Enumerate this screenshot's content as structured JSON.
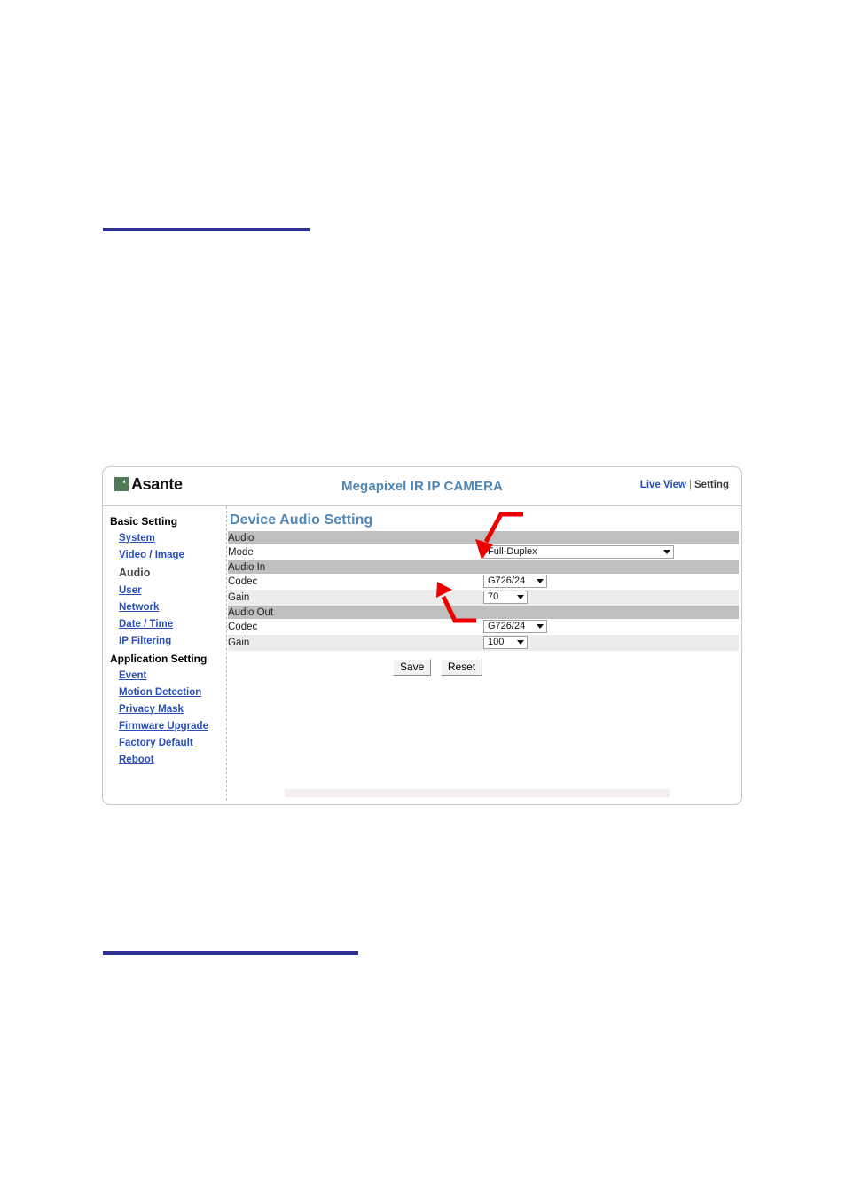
{
  "document": {
    "rules": {
      "color": "#2e3192"
    }
  },
  "ui": {
    "header": {
      "logo_icon": "asante-logo-mark",
      "logo_text": "Asante",
      "brand_title": "Megapixel IR IP CAMERA",
      "live_view_label": "Live View",
      "separator": "|",
      "setting_label": "Setting"
    },
    "sidebar": {
      "groups": [
        {
          "title": "Basic Setting",
          "items": [
            {
              "label": "System",
              "active": false
            },
            {
              "label": "Video / Image",
              "active": false
            },
            {
              "label": "Audio",
              "active": true
            },
            {
              "label": "User",
              "active": false
            },
            {
              "label": "Network",
              "active": false
            },
            {
              "label": "Date / Time",
              "active": false
            },
            {
              "label": "IP Filtering",
              "active": false
            }
          ]
        },
        {
          "title": "Application Setting",
          "items": [
            {
              "label": "Event",
              "active": false
            },
            {
              "label": "Motion Detection",
              "active": false
            },
            {
              "label": "Privacy Mask",
              "active": false
            },
            {
              "label": "Firmware Upgrade",
              "active": false
            },
            {
              "label": "Factory Default",
              "active": false
            },
            {
              "label": "Reboot",
              "active": false
            }
          ]
        }
      ]
    },
    "content": {
      "page_title": "Device Audio Setting",
      "sections": [
        {
          "header": "Audio",
          "rows": [
            {
              "label": "Mode",
              "value": "Full-Duplex",
              "control": "select-wide"
            }
          ]
        },
        {
          "header": "Audio In",
          "rows": [
            {
              "label": "Codec",
              "value": "G726/24",
              "control": "select-codec"
            },
            {
              "label": "Gain",
              "value": "70",
              "control": "select-gain"
            }
          ]
        },
        {
          "header": "Audio Out",
          "rows": [
            {
              "label": "Codec",
              "value": "G726/24",
              "control": "select-codec"
            },
            {
              "label": "Gain",
              "value": "100",
              "control": "select-gain"
            }
          ]
        }
      ],
      "buttons": {
        "save_label": "Save",
        "reset_label": "Reset"
      }
    },
    "annotations": {
      "color": "#ee0000",
      "arrows": [
        {
          "name": "arrow-to-mode-dropdown",
          "target": "Mode"
        },
        {
          "name": "arrow-to-audio-in-codec-dropdown",
          "target": "Audio In Codec"
        }
      ]
    },
    "colors": {
      "brand_blue": "#4f86b5",
      "link_blue": "#2a4fb8",
      "rule_blue": "#2e3192",
      "section_gray": "#bfbfbf",
      "stripe_gray": "#ececec",
      "logo_green": "#4e7a56",
      "annotation_red": "#ee0000"
    }
  }
}
